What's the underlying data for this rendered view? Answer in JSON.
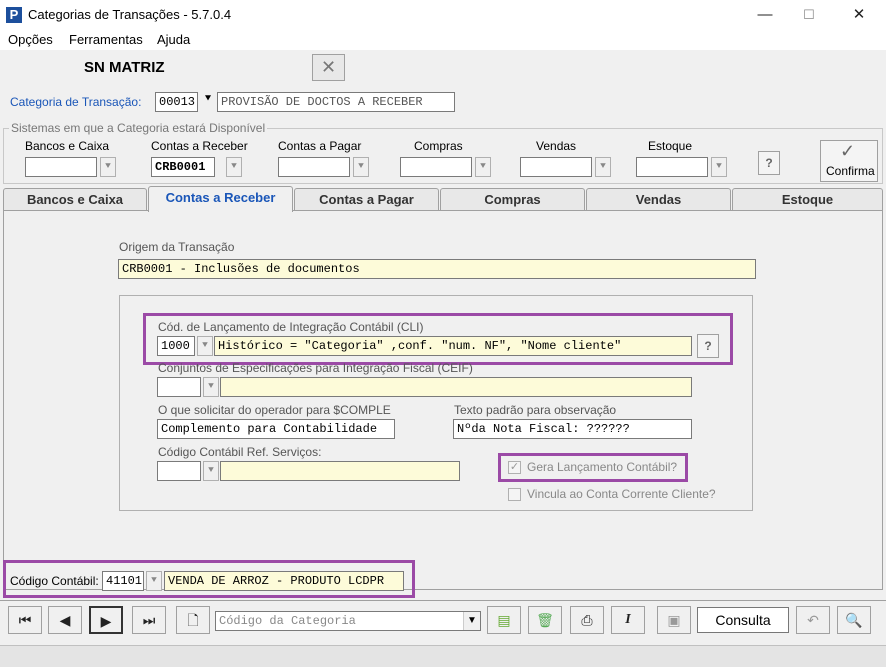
{
  "window": {
    "title": "Categorias de Transações - 5.7.0.4",
    "app_icon_letter": "P",
    "min": "—",
    "max": "☐",
    "close": "✕"
  },
  "menu": [
    "Opções",
    "Ferramentas",
    "Ajuda"
  ],
  "company": "SN MATRIZ",
  "close_doc": "✕",
  "categoria": {
    "label": "Categoria de Transação:",
    "code": "00013",
    "description": "PROVISÃO DE DOCTOS A RECEBER"
  },
  "sistemas": {
    "group_label": "Sistemas em que a Categoria estará Disponível",
    "columns": [
      {
        "label": "Bancos e Caixa",
        "value": ""
      },
      {
        "label": "Contas a Receber",
        "value": "CRB0001"
      },
      {
        "label": "Contas a Pagar",
        "value": ""
      },
      {
        "label": "Compras",
        "value": ""
      },
      {
        "label": "Vendas",
        "value": ""
      },
      {
        "label": "Estoque",
        "value": ""
      }
    ],
    "help": "?",
    "confirm_label": "Confirma",
    "confirm_icon": "✓"
  },
  "tabs": [
    "Bancos e Caixa",
    "Contas a Receber",
    "Contas a Pagar",
    "Compras",
    "Vendas",
    "Estoque"
  ],
  "active_tab": "Contas a Receber",
  "origem": {
    "label": "Origem da Transação",
    "value": "CRB0001 - Inclusões de documentos"
  },
  "cli": {
    "label": "Cód. de Lançamento de Integração Contábil (CLI)",
    "code": "1000",
    "value": "Histórico = \"Categoria\" ,conf. \"num. NF\", \"Nome cliente\"",
    "help": "?"
  },
  "ceif": {
    "label": "Conjuntos de Especificações para Integração Fiscal (CEIF)",
    "code": "",
    "value": ""
  },
  "comple": {
    "label": "O que solicitar do operador para $COMPLE",
    "value": "Complemento para Contabilidade"
  },
  "obs": {
    "label": "Texto padrão para observação",
    "value": "Nºda Nota Fiscal: ??????"
  },
  "servicos": {
    "label": "Código Contábil Ref. Serviços:",
    "code": "",
    "value": ""
  },
  "gera": {
    "label": "Gera Lançamento Contábil?",
    "checked": true
  },
  "vincula": {
    "label": "Vincula ao Conta Corrente Cliente?",
    "checked": false
  },
  "codigo_contabil": {
    "label": "Código Contábil:",
    "code": "41101",
    "value": "VENDA DE ARROZ - PRODUTO LCDPR"
  },
  "toolbar": {
    "first": "⏮",
    "prev": "◀",
    "next": "▶",
    "last": "⏭",
    "new": "🗋",
    "search_placeholder": "Código da Categoria",
    "mode": "Consulta",
    "undo": "↶",
    "find": "🔍"
  }
}
